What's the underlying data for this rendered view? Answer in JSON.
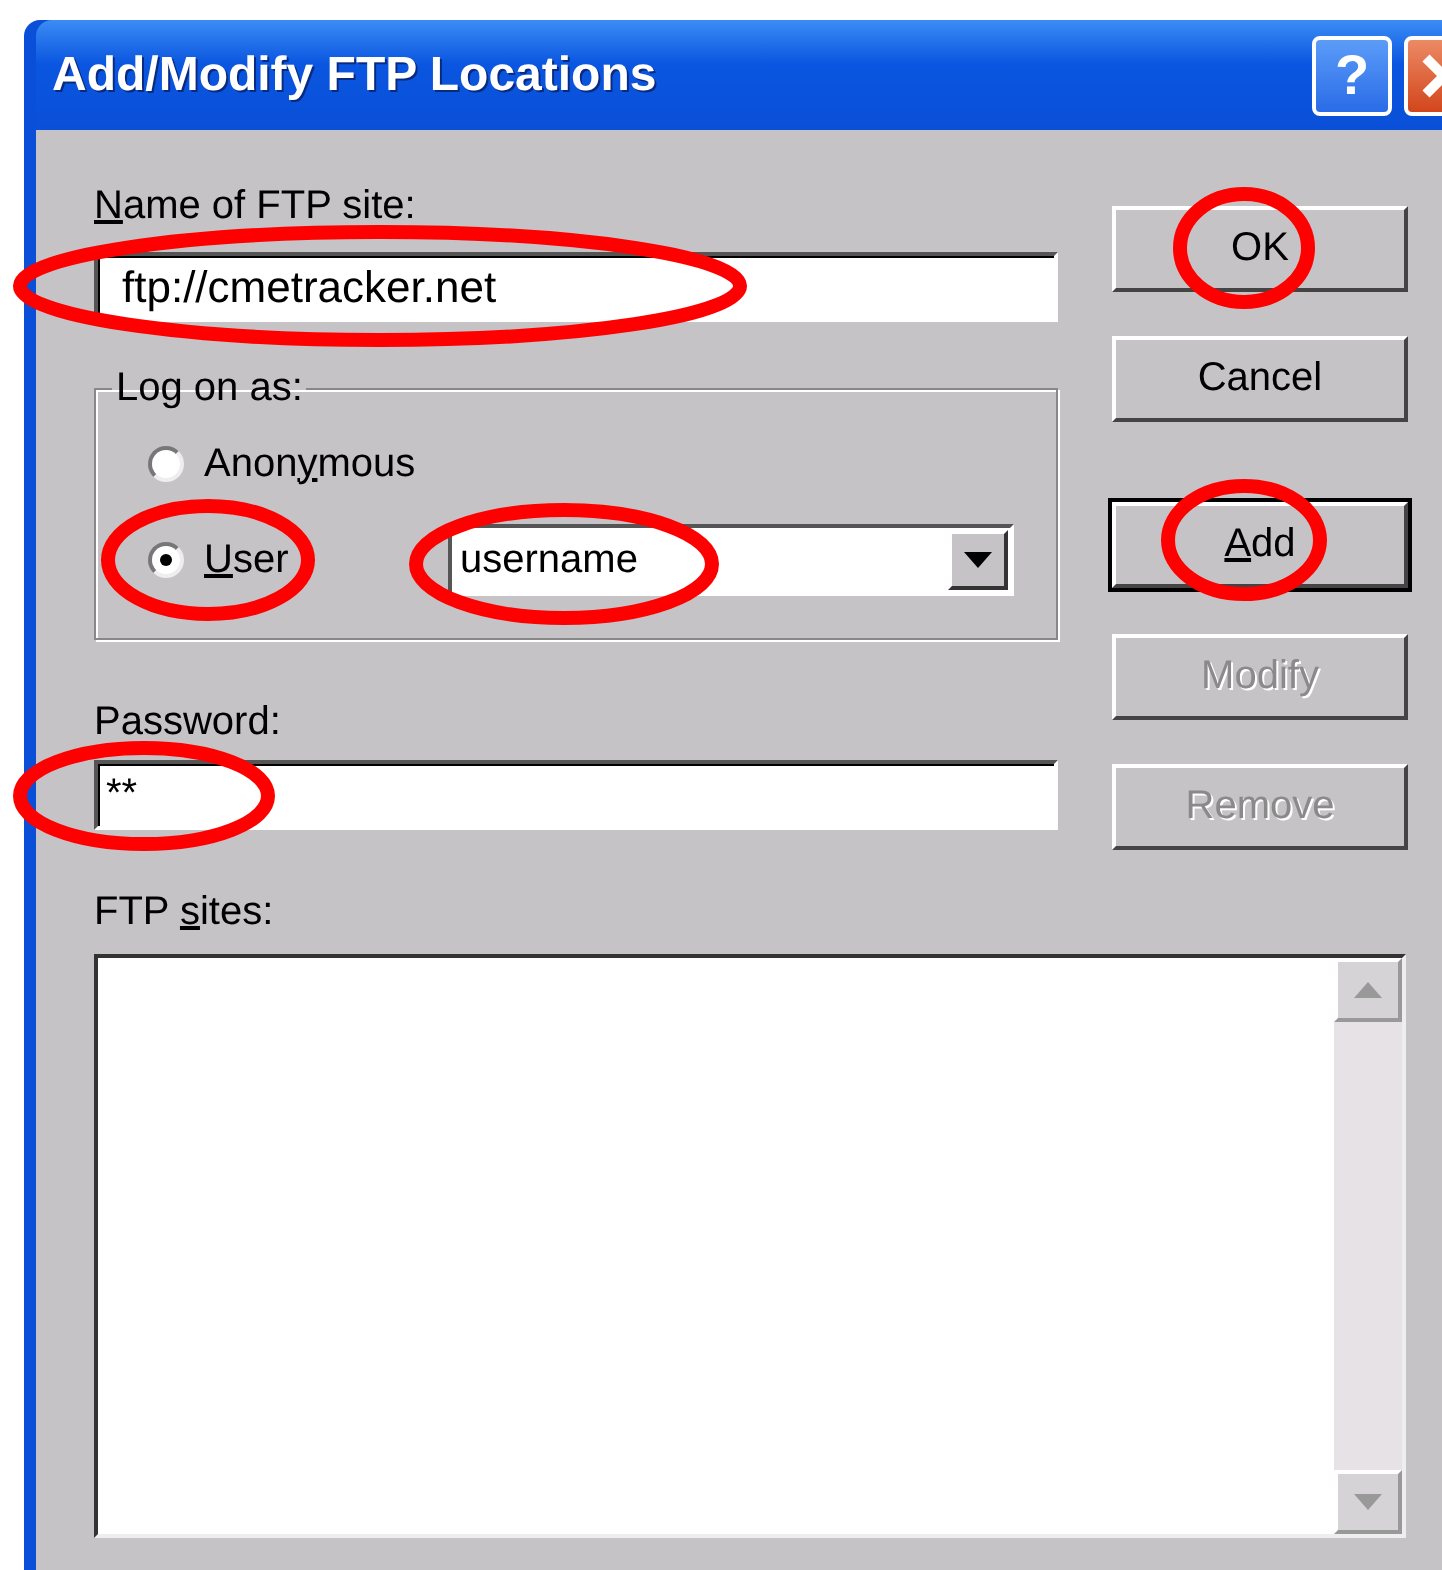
{
  "window": {
    "title": "Add/Modify FTP Locations"
  },
  "help_button": {
    "label": "?"
  },
  "site_name": {
    "label": {
      "key": "N",
      "post": "ame of FTP site:"
    },
    "value": "ftp://cmetracker.net"
  },
  "log_on_as": {
    "legend": "Log on as:",
    "options": [
      {
        "label": {
          "pre": "Anon",
          "key": "y",
          "post": "mous"
        },
        "selected": false
      },
      {
        "label": {
          "key": "U",
          "post": "ser"
        },
        "selected": true
      }
    ],
    "user_combo": {
      "value": "username"
    }
  },
  "password": {
    "label": {
      "pre": "Password:"
    },
    "value": "**"
  },
  "buttons": [
    {
      "label": {
        "pre": "OK"
      },
      "disabled": false,
      "default": false
    },
    {
      "label": {
        "pre": "Cancel"
      },
      "disabled": false,
      "default": false
    },
    {
      "label": {
        "key": "A",
        "post": "dd"
      },
      "disabled": false,
      "default": true
    },
    {
      "label": {
        "pre": "Modify"
      },
      "disabled": true,
      "default": false
    },
    {
      "label": {
        "pre": "Remove"
      },
      "disabled": true,
      "default": false
    }
  ],
  "ftp_sites": {
    "label": {
      "pre": "FTP ",
      "key": "s",
      "post": "ites:"
    }
  }
}
